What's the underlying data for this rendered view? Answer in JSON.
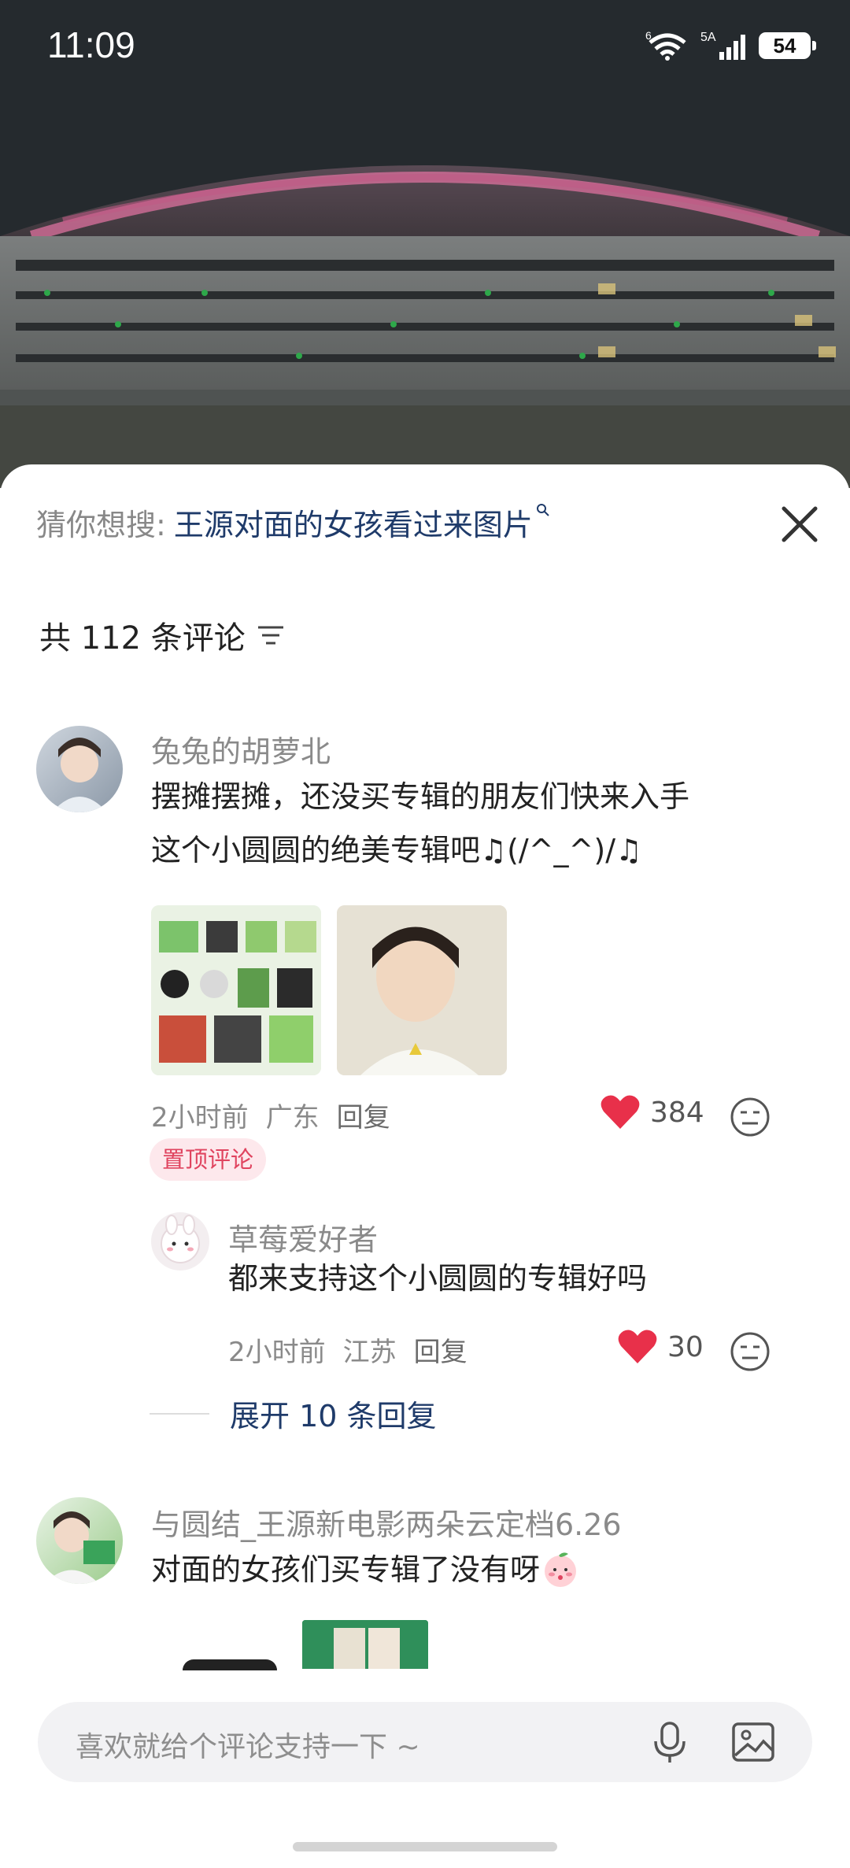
{
  "status": {
    "time": "11:09",
    "wifi_badge": "6",
    "signal_badge": "5A",
    "battery": "54"
  },
  "hero": {
    "icon": "stadium-night-photo"
  },
  "search_suggest": {
    "label": "猜你想搜:",
    "query": "王源对面的女孩看过来图片",
    "sup_icon": "search-icon"
  },
  "comments_header": {
    "count_text": "共 112 条评论",
    "sort_icon": "sort-icon"
  },
  "comment1": {
    "user": "兔兔的胡萝北",
    "text_line1": "摆摊摆摊，还没买专辑的朋友们快来入手",
    "text_line2": "这个小圆圆的绝美专辑吧♫(/^_^)/♫",
    "time": "2小时前",
    "region": "广东",
    "reply": "回复",
    "likes": "384",
    "pinned": "置顶评论"
  },
  "reply1": {
    "user": "草莓爱好者",
    "text": "都来支持这个小圆圆的专辑好吗",
    "time": "2小时前",
    "region": "江苏",
    "reply": "回复",
    "likes": "30"
  },
  "expand_replies": "展开 10 条回复",
  "comment2": {
    "user": "与圆结_王源新电影两朵云定档6.26",
    "text": "对面的女孩们买专辑了没有呀"
  },
  "input": {
    "placeholder": "喜欢就给个评论支持一下 ~"
  },
  "colors": {
    "like_red": "#e8304a",
    "link_blue": "#1f3b6a",
    "pin_bg": "#fde8ec"
  }
}
